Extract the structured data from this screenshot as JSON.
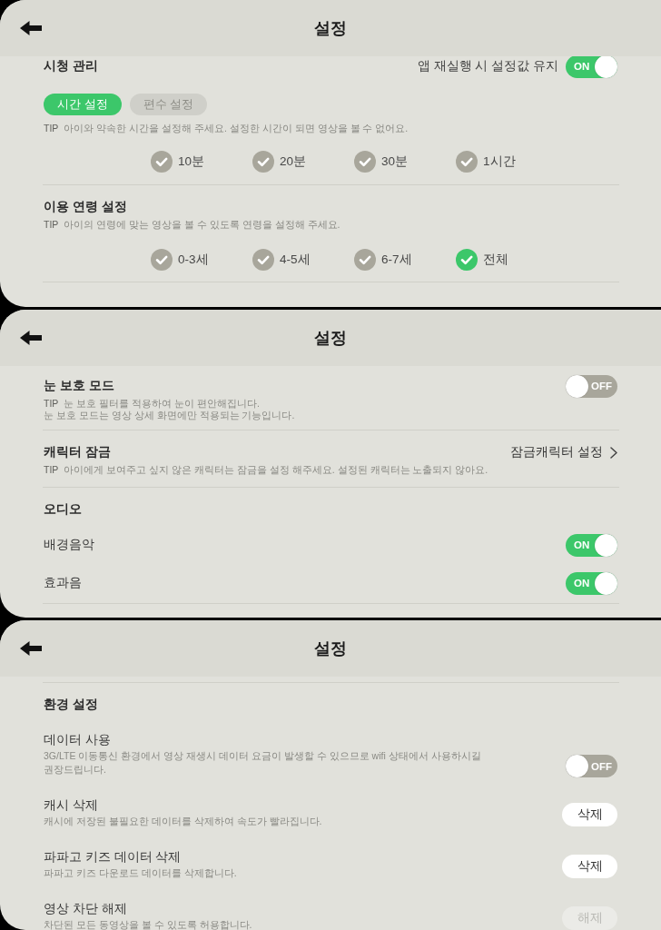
{
  "screens": [
    {
      "title": "설정",
      "sections": [
        {
          "heading": "시청 관리",
          "control": {
            "kind": "toggle",
            "label": "앱 재실행 시 설정값 유지",
            "on": true,
            "text": "ON"
          },
          "tabs": [
            {
              "label": "시간 설정",
              "selected": true
            },
            {
              "label": "편수 설정",
              "selected": false
            }
          ],
          "tip": {
            "label": "TIP",
            "lines": [
              "아이와 약속한 시간을 설정해 주세요. 설정한 시간이 되면 영상을 볼 수 없어요."
            ]
          },
          "options": [
            {
              "label": "10분",
              "selected": false
            },
            {
              "label": "20분",
              "selected": false
            },
            {
              "label": "30분",
              "selected": false
            },
            {
              "label": "1시간",
              "selected": false
            }
          ]
        },
        {
          "heading": "이용 연령 설정",
          "tip": {
            "label": "TIP",
            "lines": [
              "아이의 연령에 맞는 영상을 볼 수 있도록 연령을 설정해 주세요."
            ]
          },
          "options": [
            {
              "label": "0-3세",
              "selected": false
            },
            {
              "label": "4-5세",
              "selected": false
            },
            {
              "label": "6-7세",
              "selected": false
            },
            {
              "label": "전체",
              "selected": true
            }
          ]
        }
      ]
    },
    {
      "title": "설정",
      "sections": [
        {
          "heading": "눈 보호 모드",
          "control": {
            "kind": "toggle",
            "on": false,
            "text": "OFF"
          },
          "tip": {
            "label": "TIP",
            "lines": [
              "눈 보호 필터를 적용하여 눈이 편안해집니다.",
              "눈 보호 모드는 영상 상세 화면에만 적용되는 기능입니다."
            ]
          }
        },
        {
          "heading": "캐릭터 잠금",
          "control": {
            "kind": "link",
            "label": "잠금캐릭터 설정"
          },
          "tip": {
            "label": "TIP",
            "lines": [
              "아이에게 보여주고 싶지 않은 캐릭터는 잠금을 설정 해주세요. 설정된 캐릭터는 노출되지 않아요."
            ]
          }
        },
        {
          "heading": "오디오",
          "items": [
            {
              "label": "배경음악",
              "control": {
                "kind": "toggle",
                "on": true,
                "text": "ON"
              }
            },
            {
              "label": "효과음",
              "control": {
                "kind": "toggle",
                "on": true,
                "text": "ON"
              }
            }
          ]
        }
      ]
    },
    {
      "title": "설정",
      "sections": [
        {
          "heading": "환경 설정",
          "items": [
            {
              "label": "데이터 사용",
              "description": "3G/LTE 이동통신 환경에서 영상 재생시 데이터 요금이 발생할 수 있으므로 wifi 상태에서 사용하시길 권장드립니다.",
              "control": {
                "kind": "toggle",
                "on": false,
                "text": "OFF"
              }
            },
            {
              "label": "캐시 삭제",
              "description": "캐시에 저장된 불필요한 데이터를 삭제하여 속도가 빨라집니다.",
              "control": {
                "kind": "button",
                "label": "삭제",
                "disabled": false
              }
            },
            {
              "label": "파파고 키즈 데이터 삭제",
              "description": "파파고 키즈 다운로드 데이터를 삭제합니다.",
              "control": {
                "kind": "button",
                "label": "삭제",
                "disabled": false
              }
            },
            {
              "label": "영상 차단 해제",
              "description": "차단된 모든 동영상을 볼 수 있도록 허용합니다.",
              "control": {
                "kind": "button",
                "label": "해제",
                "disabled": true
              }
            }
          ]
        }
      ]
    }
  ]
}
